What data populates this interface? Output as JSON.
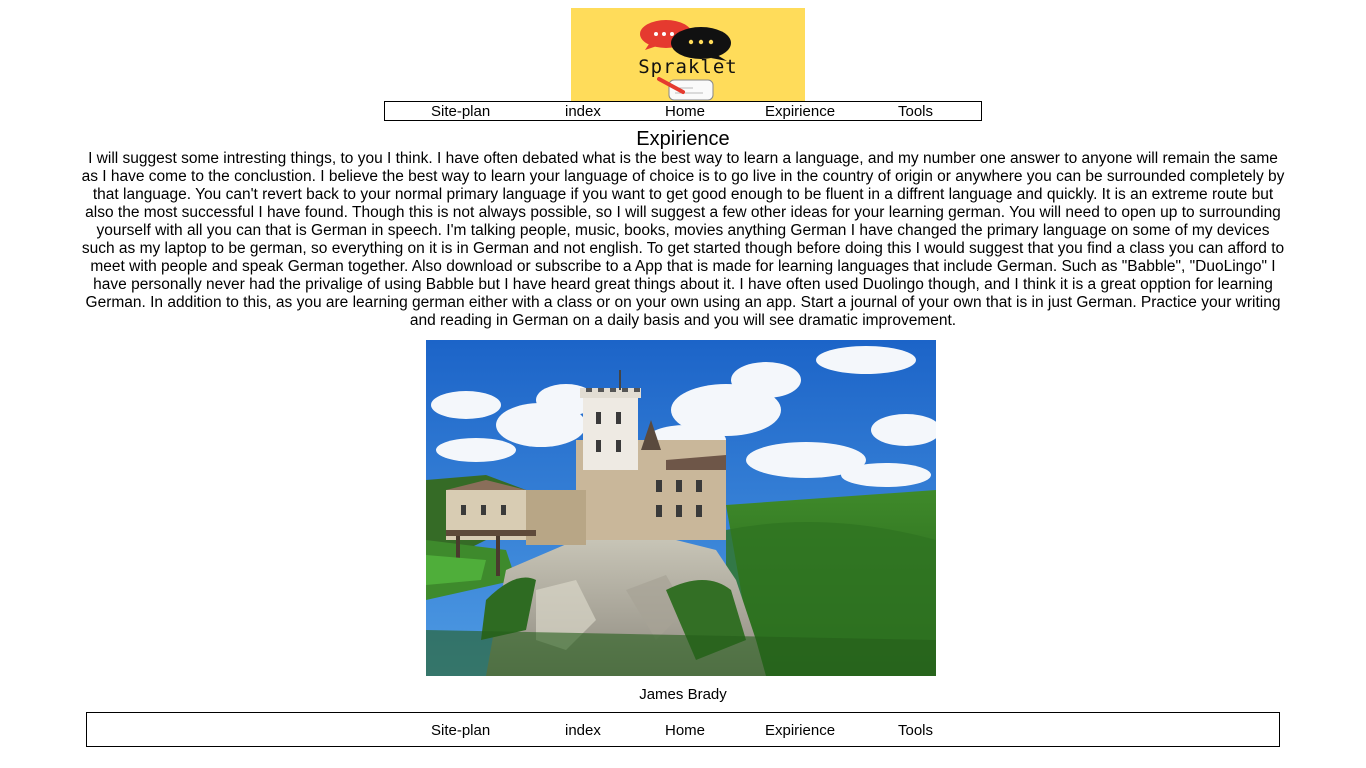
{
  "logo": {
    "text": "Spraklet",
    "colors": {
      "background": "#ffdc5a",
      "bubble_red": "#e53a2f",
      "bubble_black": "#111111"
    }
  },
  "nav": {
    "items": [
      {
        "label": "Site-plan"
      },
      {
        "label": "index"
      },
      {
        "label": "Home"
      },
      {
        "label": "Expirience"
      },
      {
        "label": "Tools"
      }
    ]
  },
  "main": {
    "heading": "Expirience",
    "paragraph": "I will suggest some intresting things, to you I think. I have often debated what is the best way to learn a language, and my number one answer to anyone will remain the same as I have come to the conclustion. I believe the best way to learn your language of choice is to go live in the country of origin or anywhere you can be surrounded completely by that language. You can't revert back to your normal primary language if you want to get good enough to be fluent in a diffrent language and quickly. It is an extreme route but also the most successful I have found. Though this is not always possible, so I will suggest a few other ideas for your learning german. You will need to open up to surrounding yourself with all you can that is German in speech. I'm talking people, music, books, movies anything German I have changed the primary language on some of my devices such as my laptop to be german, so everything on it is in German and not english. To get started though before doing this I would suggest that you find a class you can afford to meet with people and speak German together. Also download or subscribe to a App that is made for learning languages that include German. Such as \"Babble\", \"DuoLingo\" I have personally never had the privalige of using Babble but I have heard great things about it. I have often used Duolingo though, and I think it is a great opption for learning German. In addition to this, as you are learning german either with a class or on your own using an app. Start a journal of your own that is in just German. Practice your writing and reading in German on a daily basis and you will see dramatic improvement.",
    "author": "James Brady"
  }
}
